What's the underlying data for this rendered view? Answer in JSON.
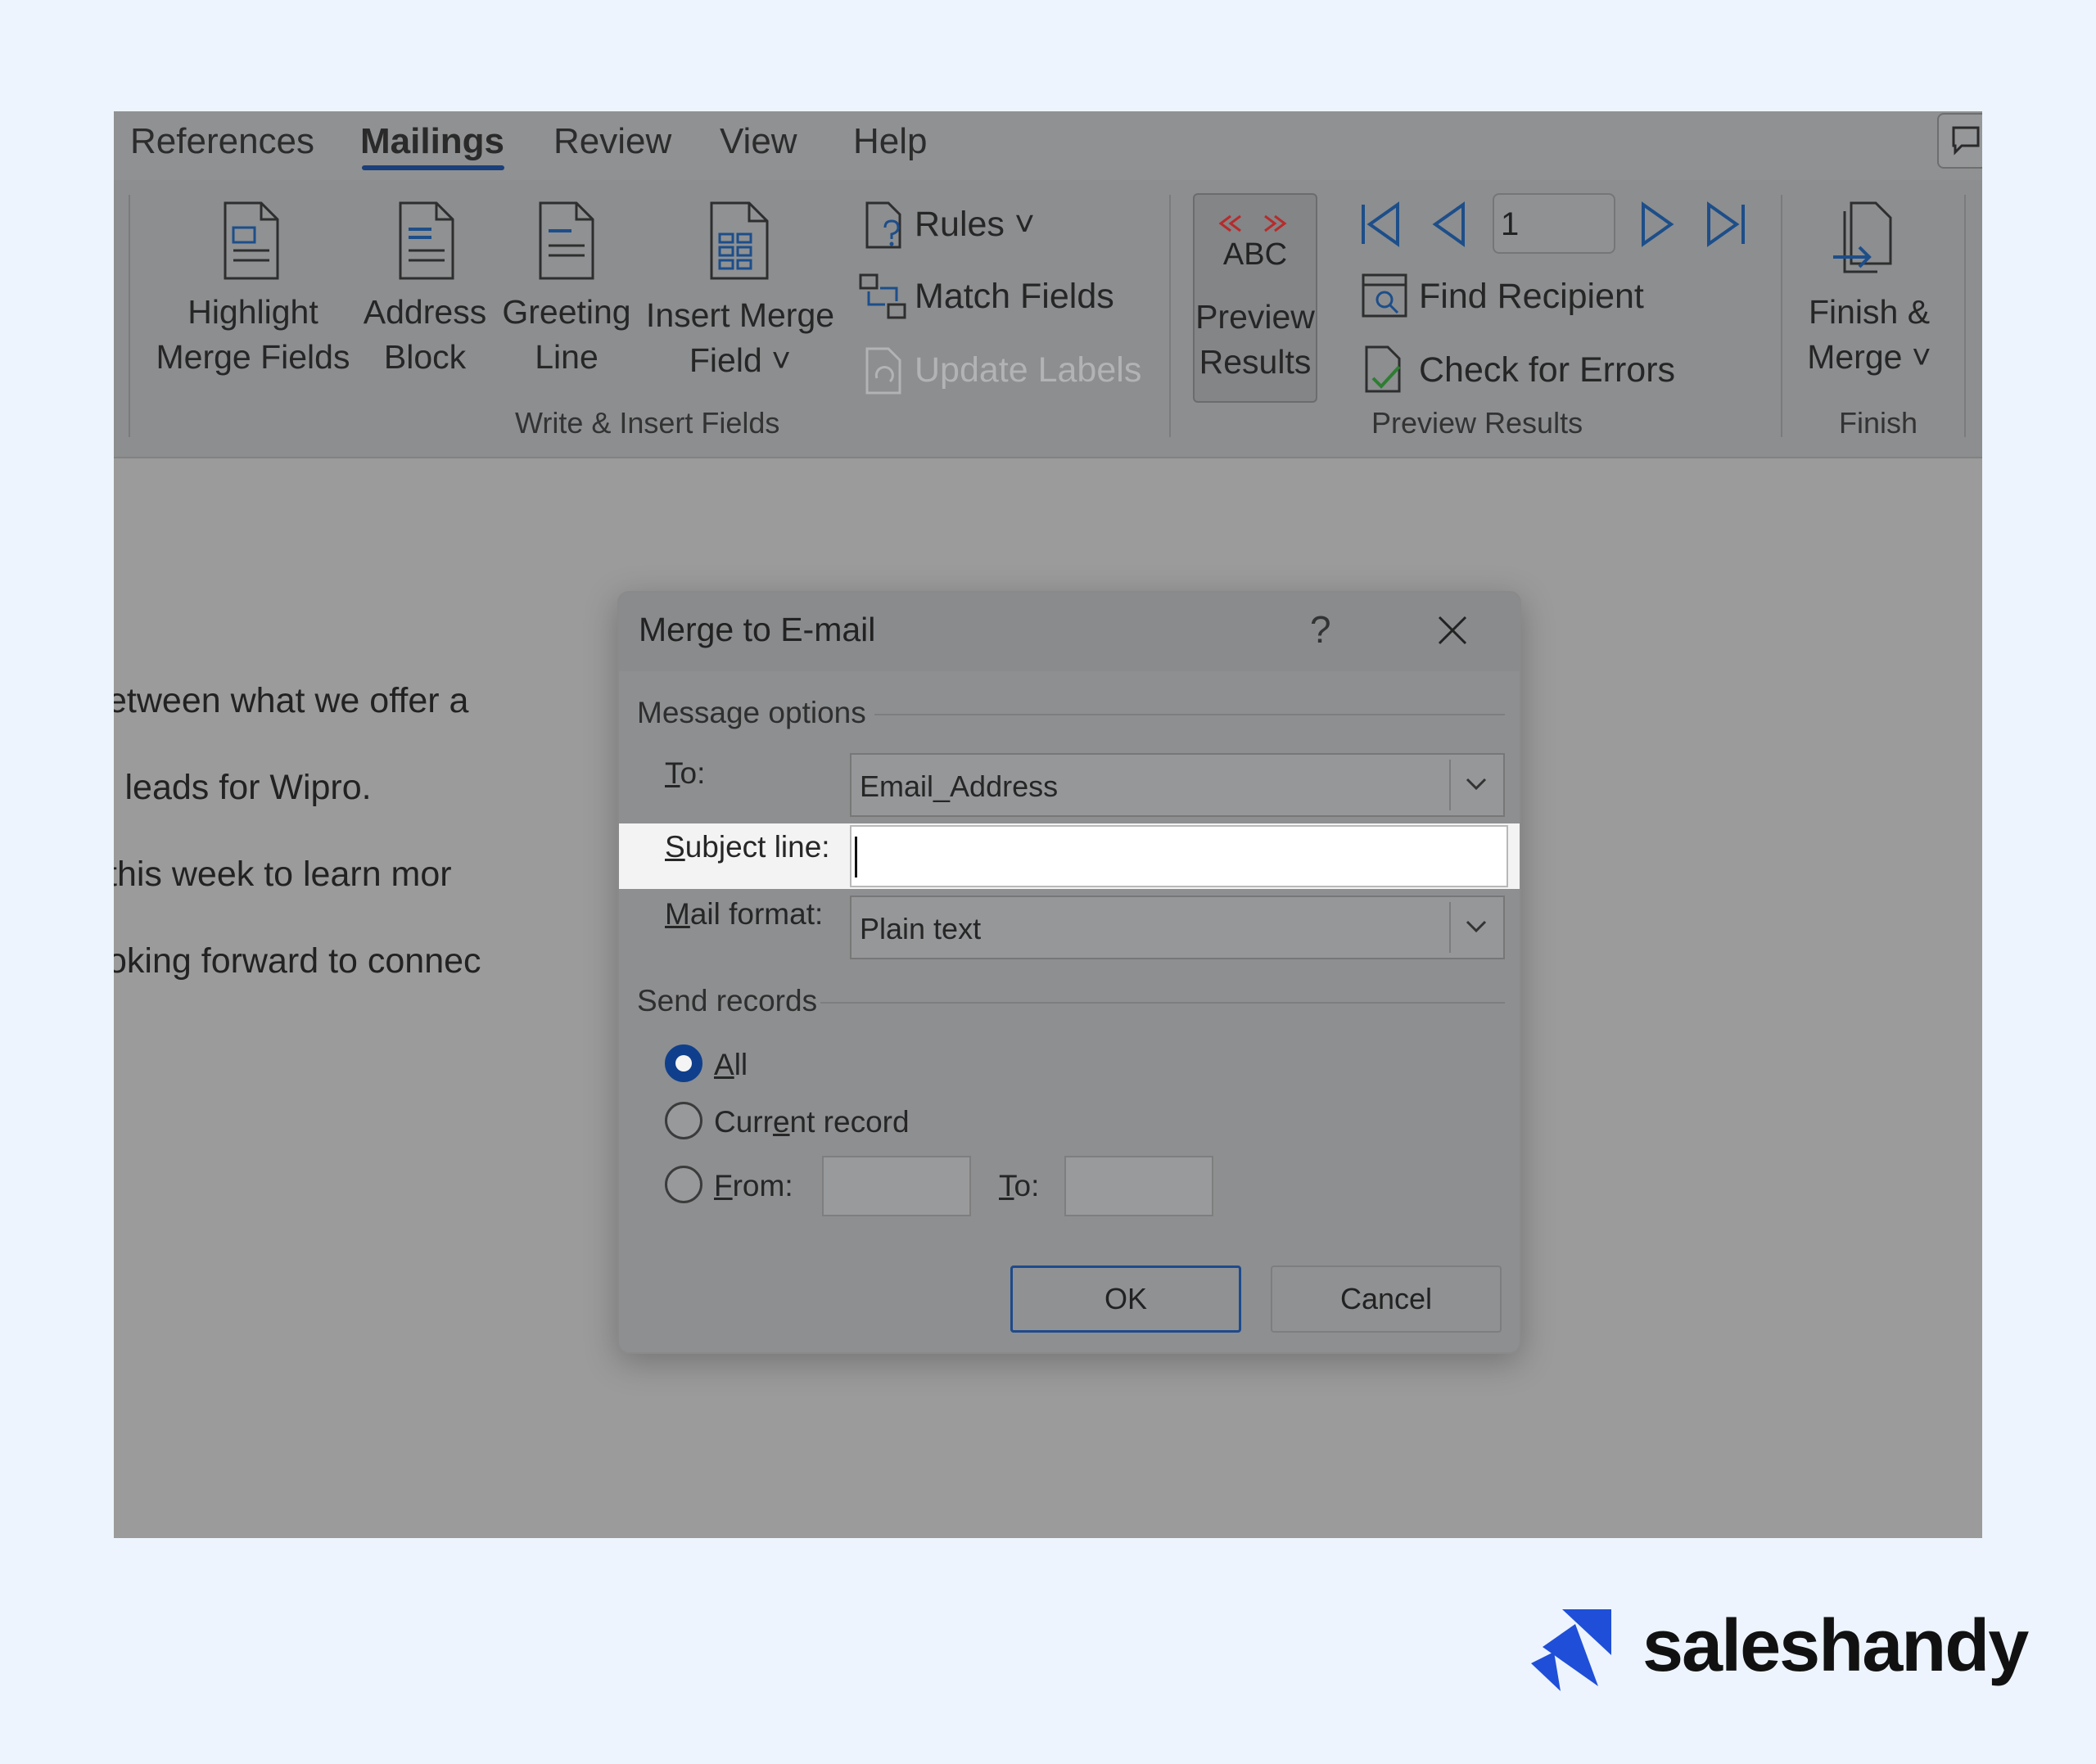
{
  "tabs": {
    "references": "References",
    "mailings": "Mailings",
    "review": "Review",
    "view": "View",
    "help": "Help"
  },
  "ribbon": {
    "highlight": [
      "Highlight",
      "Merge Fields"
    ],
    "address": [
      "Address",
      "Block"
    ],
    "greeting": [
      "Greeting",
      "Line"
    ],
    "insert_merge": [
      "Insert Merge",
      "Field ˅"
    ],
    "rules": "Rules ˅",
    "match_fields": "Match Fields",
    "update_labels": "Update Labels",
    "write_group": "Write & Insert Fields",
    "preview_abc": "ABC",
    "preview_results_btn": [
      "Preview",
      "Results"
    ],
    "record_number": "1",
    "find_recipient": "Find Recipient",
    "check_errors": "Check for Errors",
    "preview_group": "Preview Results",
    "finish_merge": [
      "Finish &",
      "Merge ˅"
    ],
    "finish_group": "Finish"
  },
  "document": {
    "lines": [
      "etween what we offer a",
      "l leads for Wipro.",
      " this week to learn mor",
      "oking forward to connec"
    ]
  },
  "dialog": {
    "title": "Merge to E-mail",
    "help": "?",
    "message_options": "Message options",
    "to_label_u": "T",
    "to_label_rest": "o:",
    "to_value": "Email_Address",
    "subject_label_u": "S",
    "subject_label_rest": "ubject line:",
    "subject_value": "",
    "mail_format_label_u": "M",
    "mail_format_label_rest": "ail format:",
    "mail_format_value": "Plain text",
    "send_records": "Send records",
    "all_u": "A",
    "all_rest": "ll",
    "current_pre": "Curr",
    "current_u": "e",
    "current_rest": "nt record",
    "from_u": "F",
    "from_rest": "rom:",
    "to2_u": "T",
    "to2_rest": "o:",
    "from_value": "",
    "to_range_value": "",
    "selected_option": "All",
    "ok": "OK",
    "cancel": "Cancel"
  },
  "brand": {
    "name": "saleshandy",
    "accent": "#1f4fd8"
  }
}
